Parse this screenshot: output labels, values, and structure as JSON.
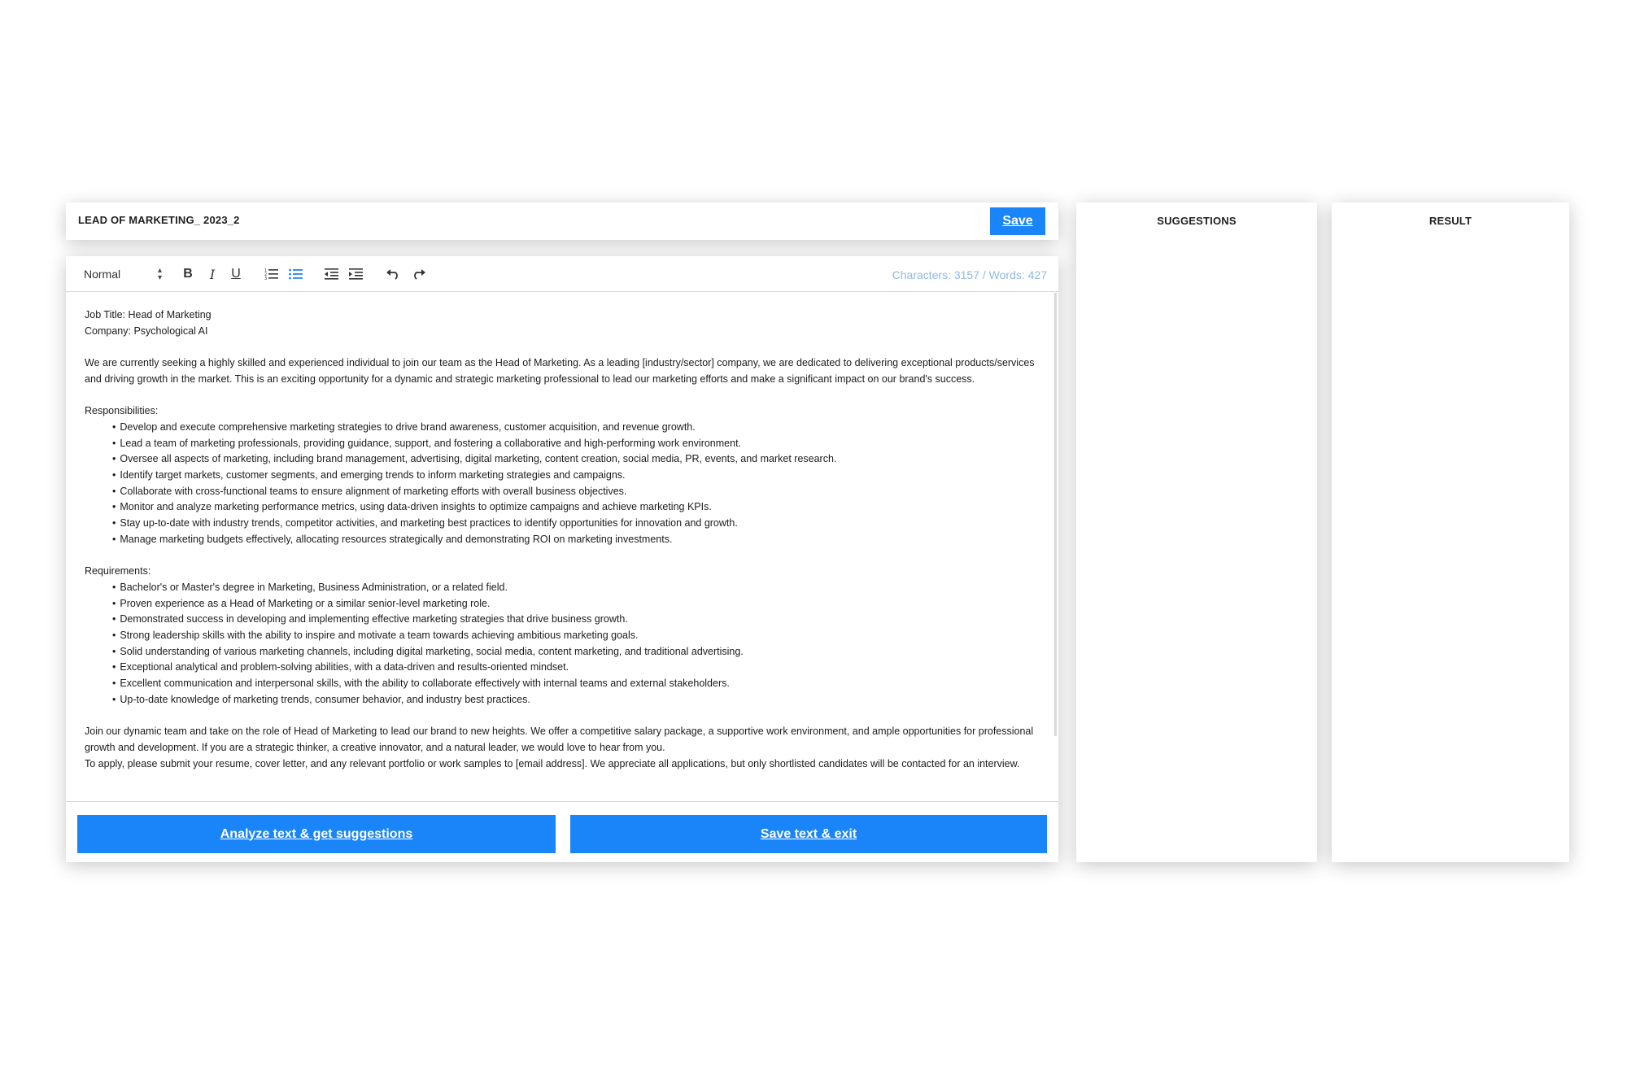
{
  "document": {
    "title": "LEAD OF MARKETING_ 2023_2",
    "save_label": "Save"
  },
  "toolbar": {
    "format_value": "Normal",
    "bold_label": "B",
    "italic_label": "I",
    "underline_label": "U",
    "counter": "Characters: 3157 / Words: 427",
    "icons": [
      "bold-icon",
      "italic-icon",
      "underline-icon",
      "ordered-list-icon",
      "bullet-list-icon",
      "outdent-icon",
      "indent-icon",
      "undo-icon",
      "redo-icon"
    ],
    "active_color": "#1a85f8"
  },
  "content": {
    "job_title": "Job Title: Head of Marketing",
    "company": "Company: Psychological AI",
    "intro": "We are currently seeking a highly skilled and experienced individual to join our team as the Head of Marketing. As a leading [industry/sector] company, we are dedicated to delivering exceptional products/services and driving growth in the market. This is an exciting opportunity for a dynamic and strategic marketing professional to lead our marketing efforts and make a significant impact on our brand's success.",
    "responsibilities_heading": "Responsibilities:",
    "responsibilities": [
      "Develop and execute comprehensive marketing strategies to drive brand awareness, customer acquisition, and revenue growth.",
      "Lead a team of marketing professionals, providing guidance, support, and fostering a collaborative and high-performing work environment.",
      "Oversee all aspects of marketing, including brand management, advertising, digital marketing, content creation, social media, PR, events, and market research.",
      "Identify target markets, customer segments, and emerging trends to inform marketing strategies and campaigns.",
      "Collaborate with cross-functional teams to ensure alignment of marketing efforts with overall business objectives.",
      "Monitor and analyze marketing performance metrics, using data-driven insights to optimize campaigns and achieve marketing KPIs.",
      "Stay up-to-date with industry trends, competitor activities, and marketing best practices to identify opportunities for innovation and growth.",
      "Manage marketing budgets effectively, allocating resources strategically and demonstrating ROI on marketing investments."
    ],
    "requirements_heading": "Requirements:",
    "requirements": [
      "Bachelor's or Master's degree in Marketing, Business Administration, or a related field.",
      "Proven experience as a Head of Marketing or a similar senior-level marketing role.",
      "Demonstrated success in developing and implementing effective marketing strategies that drive business growth.",
      "Strong leadership skills with the ability to inspire and motivate a team towards achieving ambitious marketing goals.",
      "Solid understanding of various marketing channels, including digital marketing, social media, content marketing, and traditional advertising.",
      "Exceptional analytical and problem-solving abilities, with a data-driven and results-oriented mindset.",
      "Excellent communication and interpersonal skills, with the ability to collaborate effectively with internal teams and external stakeholders.",
      "Up-to-date knowledge of marketing trends, consumer behavior, and industry best practices."
    ],
    "closing": "Join our dynamic team and take on the role of Head of Marketing to lead our brand to new heights. We offer a competitive salary package, a supportive work environment, and ample opportunities for professional growth and development. If you are a strategic thinker, a creative innovator, and a natural leader, we would love to hear from you.",
    "apply": "To apply, please submit your resume, cover letter, and any relevant portfolio or work samples to [email address]. We appreciate all applications, but only shortlisted candidates will be contacted for an interview."
  },
  "actions": {
    "analyze_label": "Analyze text & get suggestions",
    "save_exit_label": "Save text & exit"
  },
  "panels": {
    "suggestions_title": "SUGGESTIONS",
    "result_title": "RESULT"
  },
  "colors": {
    "accent": "#1a85f8",
    "counter": "#8fb8e4"
  }
}
